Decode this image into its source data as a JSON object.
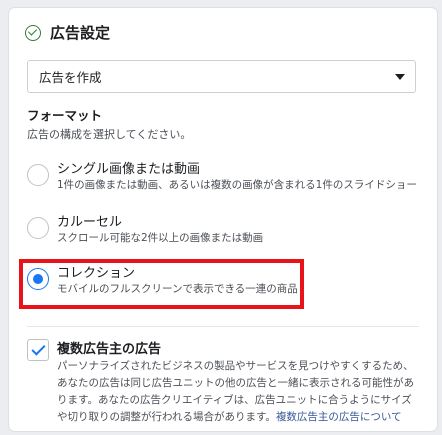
{
  "section": {
    "title": "広告設定"
  },
  "dropdown": {
    "value": "広告を作成"
  },
  "format": {
    "label": "フォーマット",
    "description": "広告の構成を選択してください。",
    "options": [
      {
        "title": "シングル画像または動画",
        "desc": "1件の画像または動画、あるいは複数の画像が含まれる1件のスライドショー",
        "selected": false
      },
      {
        "title": "カルーセル",
        "desc": "スクロール可能な2件以上の画像または動画",
        "selected": false
      },
      {
        "title": "コレクション",
        "desc": "モバイルのフルスクリーンで表示できる一連の商品",
        "selected": true
      }
    ]
  },
  "multi_advertiser": {
    "title": "複数広告主の広告",
    "checked": true,
    "desc": "パーソナライズされたビジネスの製品やサービスを見つけやすくするため、あなたの広告は同じ広告ユニットの他の広告と一緒に表示される可能性があります。あなたの広告クリエイティブは、広告ユニットに合うようにサイズや切り取りの調整が行われる場合があります。",
    "link": "複数広告主の広告について"
  },
  "colors": {
    "accent": "#1877f2",
    "highlight": "#e8141a",
    "success": "#2e7d32"
  }
}
